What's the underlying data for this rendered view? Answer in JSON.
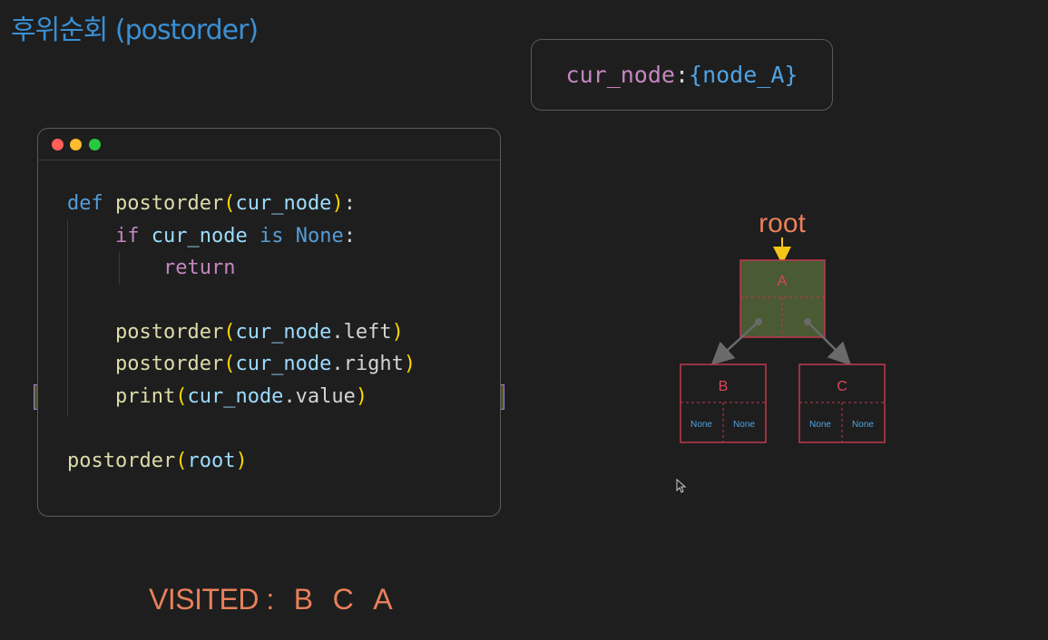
{
  "title": "후위순회 (postorder)",
  "cur_node": {
    "name": "cur_node",
    "separator": ":",
    "value": "{node_A}"
  },
  "code": {
    "line1": {
      "kw": "def",
      "fn": "postorder",
      "open": "(",
      "param": "cur_node",
      "close": ")",
      "end": ":"
    },
    "line2": {
      "kw": "if",
      "param": "cur_node",
      "is": "is",
      "none": "None",
      "end": ":"
    },
    "line3": {
      "kw": "return"
    },
    "line4": {
      "fn": "postorder",
      "open": "(",
      "param": "cur_node",
      "attr": ".left",
      "close": ")"
    },
    "line5": {
      "fn": "postorder",
      "open": "(",
      "param": "cur_node",
      "attr": ".right",
      "close": ")"
    },
    "line6": {
      "fn": "print",
      "open": "(",
      "param": "cur_node",
      "attr": ".value",
      "close": ")"
    },
    "line7": {
      "fn": "postorder",
      "open": "(",
      "param": "root",
      "close": ")"
    }
  },
  "tree": {
    "root_label": "root",
    "nodes": {
      "A": {
        "label": "A",
        "left": "",
        "right": ""
      },
      "B": {
        "label": "B",
        "left": "None",
        "right": "None"
      },
      "C": {
        "label": "C",
        "left": "None",
        "right": "None"
      }
    },
    "colors": {
      "node_border": "#c0394f",
      "active_fill": "#4a5a32",
      "arrow": "#6a6a6a",
      "root_arrow": "#f5c518"
    }
  },
  "visited": {
    "label": "VISITED :",
    "items": [
      "B",
      "C",
      "A"
    ]
  },
  "colors": {
    "background": "#1e1e1e",
    "title": "#3b8fd3",
    "visited": "#e8805a",
    "highlight": "#4a5a32"
  }
}
